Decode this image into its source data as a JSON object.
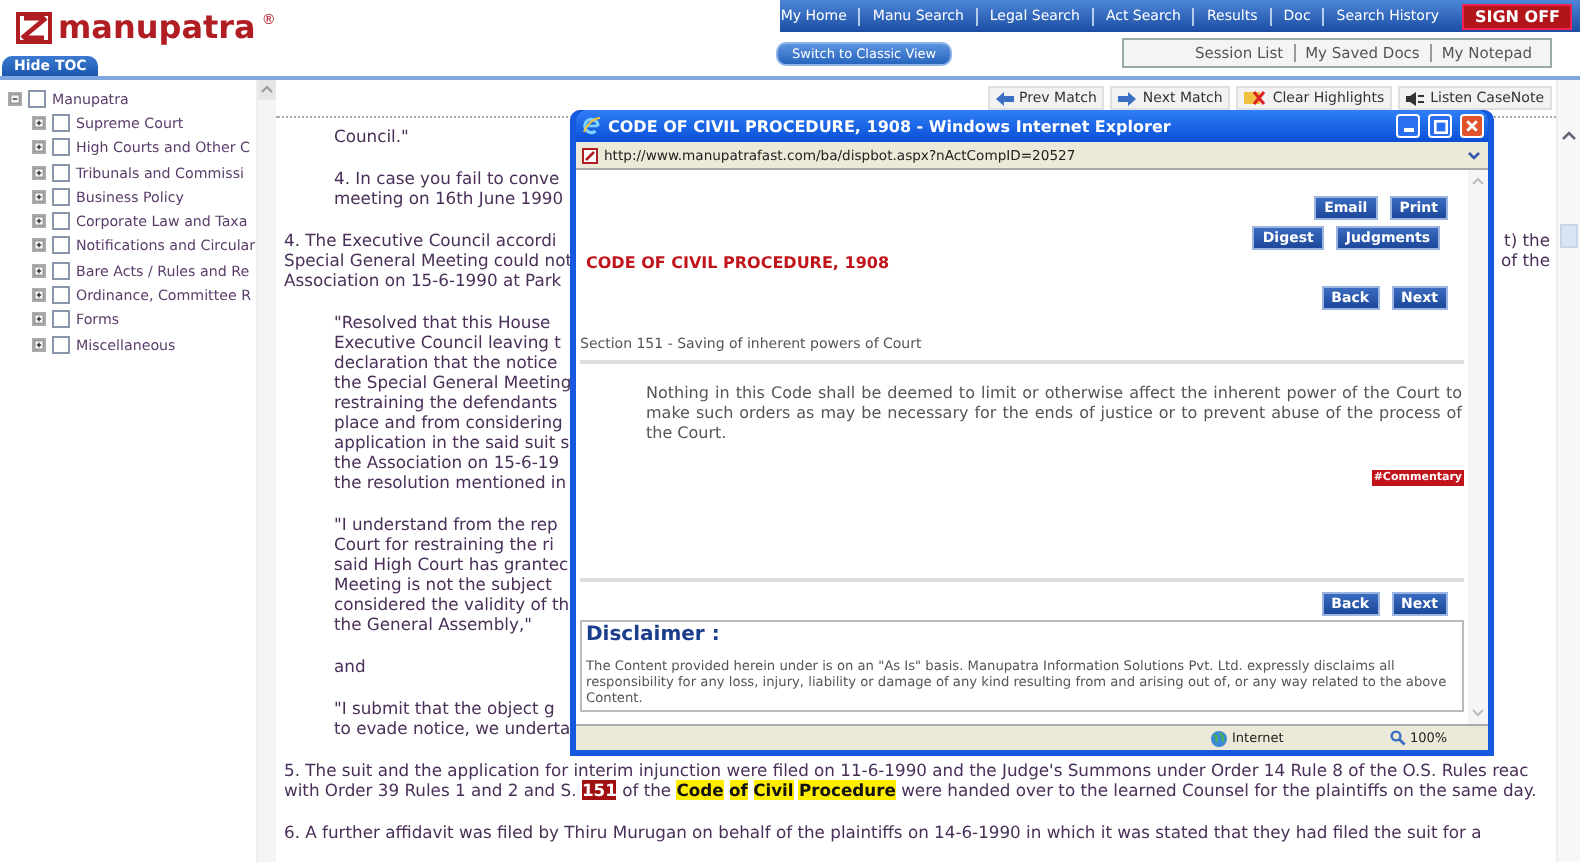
{
  "header": {
    "logo": "manupatra",
    "logo_mark": "®",
    "nav": [
      "My Home",
      "Manu Search",
      "Legal Search",
      "Act Search",
      "Results",
      "Doc",
      "Search History"
    ],
    "sign_off": "SIGN OFF",
    "classic_view": "Switch to Classic View",
    "sub_links": [
      "Session List",
      "My Saved Docs",
      "My Notepad"
    ],
    "hide_toc": "Hide TOC"
  },
  "toc": {
    "label": "Manupatra",
    "expanded": true,
    "checked": false,
    "children": [
      {
        "label": "Supreme Court",
        "expanded": false,
        "checked": false
      },
      {
        "label": "High Courts and Other C",
        "expanded": false,
        "checked": false
      },
      {
        "label": "Tribunals and Commissi",
        "expanded": false,
        "checked": false
      },
      {
        "label": "Business Policy",
        "expanded": false,
        "checked": false
      },
      {
        "label": "Corporate Law and Taxa",
        "expanded": false,
        "checked": false
      },
      {
        "label": "Notifications and Circular",
        "expanded": false,
        "checked": false
      },
      {
        "label": "Bare Acts / Rules and Re",
        "expanded": false,
        "checked": false
      },
      {
        "label": "Ordinance, Committee R",
        "expanded": false,
        "checked": false
      },
      {
        "label": "Forms",
        "expanded": false,
        "checked": false
      },
      {
        "label": "Miscellaneous",
        "expanded": false,
        "checked": false
      }
    ]
  },
  "toolbar": [
    {
      "label": "Prev Match",
      "kind": "prev"
    },
    {
      "label": "Next Match",
      "kind": "next"
    },
    {
      "label": "Clear Highlights",
      "kind": "clear"
    },
    {
      "label": "Listen CaseNote",
      "kind": "listen"
    }
  ],
  "document": [
    {
      "indent": true,
      "lines": [
        {
          "kind": "plain",
          "text": "Council.\""
        }
      ]
    },
    {
      "indent": true,
      "lines": [
        {
          "kind": "plain",
          "text": "4. In case you fail to conve"
        },
        {
          "kind": "plain",
          "text": "meeting on 16th June 1990"
        }
      ]
    },
    {
      "indent": false,
      "lines": [
        {
          "kind": "split",
          "text": "4. The Executive Council accordi",
          "tail": "t) the"
        },
        {
          "kind": "split",
          "text": "Special General Meeting could not",
          "tail": "of the"
        },
        {
          "kind": "plain",
          "text": "Association on 15-6-1990 at Park"
        }
      ]
    },
    {
      "indent": true,
      "lines": [
        {
          "kind": "plain",
          "text": "\"Resolved that this House"
        },
        {
          "kind": "plain",
          "text": "Executive Council leaving t"
        },
        {
          "kind": "plain",
          "text": "declaration that the notice"
        },
        {
          "kind": "plain",
          "text": "the Special General Meeting"
        },
        {
          "kind": "plain",
          "text": "restraining the defendants"
        },
        {
          "kind": "plain",
          "text": "place and from considering"
        },
        {
          "kind": "plain",
          "text": "application in the said suit s"
        },
        {
          "kind": "plain",
          "text": "the Association on 15-6-19"
        },
        {
          "kind": "plain",
          "text": "the resolution mentioned in"
        }
      ]
    },
    {
      "indent": true,
      "lines": [
        {
          "kind": "plain",
          "text": "\"I understand from the rep"
        },
        {
          "kind": "plain",
          "text": "Court for restraining the ri"
        },
        {
          "kind": "plain",
          "text": "said High Court has grantec"
        },
        {
          "kind": "plain",
          "text": "Meeting is not the subject"
        },
        {
          "kind": "plain",
          "text": "considered the validity of th"
        },
        {
          "kind": "plain",
          "text": "the General Assembly,\""
        }
      ]
    },
    {
      "indent": true,
      "lines": [
        {
          "kind": "plain",
          "text": "and"
        }
      ]
    },
    {
      "indent": true,
      "lines": [
        {
          "kind": "plain",
          "text": "\"I submit that the object g"
        },
        {
          "kind": "plain",
          "text": "to evade notice, we underta"
        }
      ]
    },
    {
      "indent": false,
      "lines": [
        {
          "kind": "plain",
          "text": "5. The suit and the application for interim injunction were filed on 11-6-1990 and the Judge's Summons under Order 14 Rule 8 of the O.S. Rules reac"
        },
        {
          "kind": "marked",
          "segments": [
            {
              "text": "with Order 39 Rules 1 and 2 and S."
            },
            {
              "text": "151",
              "color": "#a01010"
            },
            {
              "text": "of the"
            },
            {
              "text": "Code",
              "color": "#ffee00"
            },
            {
              "text": "of",
              "color": "#ffee00"
            },
            {
              "text": "Civil",
              "color": "#ffee00"
            },
            {
              "text": "Procedure",
              "color": "#ffee00"
            },
            {
              "text": "were handed over to the learned Counsel for the plaintiffs on the same day."
            }
          ]
        }
      ]
    },
    {
      "indent": false,
      "lines": [
        {
          "kind": "plain",
          "text": "6. A further affidavit was filed by Thiru Murugan on behalf of the plaintiffs on 14-6-1990 in which it was stated that they had filed the suit for a"
        }
      ]
    }
  ],
  "popup": {
    "title": "CODE OF CIVIL PROCEDURE, 1908 - Windows Internet Explorer",
    "address": "http://www.manupatrafast.com/ba/dispbot.aspx?nActCompID=20527",
    "top_buttons": [
      [
        "Email",
        "Print"
      ],
      [
        "Digest",
        "Judgments"
      ]
    ],
    "act_title": "CODE OF CIVIL PROCEDURE, 1908",
    "nav_buttons": [
      "Back",
      "Next"
    ],
    "section": "Section 151 - Saving of inherent powers of Court",
    "body": "Nothing in this Code shall be deemed to limit or otherwise affect the inherent power of the Court to make such orders as may be necessary for the ends of justice or to prevent abuse of the process of the Court.",
    "commentary": "#Commentary",
    "bottom_buttons": [
      "Back",
      "Next"
    ],
    "disclaimer_title": "Disclaimer :",
    "disclaimer": "The Content provided herein under is on an \"As Is\" basis. Manupatra Information Solutions Pvt. Ltd. expressly disclaims all responsibility for any loss, injury, liability or damage of any kind resulting from and arising out of, or any way related to the above Content.",
    "status_zone": "Internet",
    "zoom": "100%"
  }
}
